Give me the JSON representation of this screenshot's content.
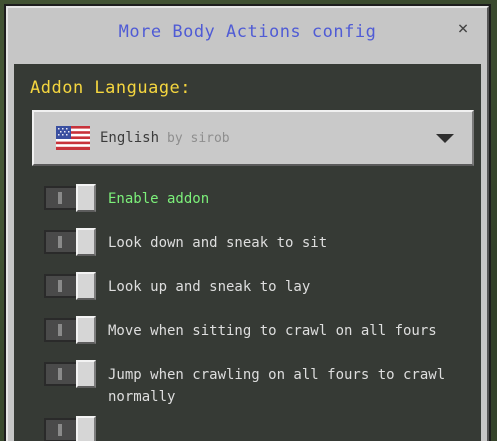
{
  "dialog": {
    "title": "More Body Actions config",
    "close_symbol": "×"
  },
  "language": {
    "heading": "Addon Language:",
    "selected": "English",
    "author": "by sirob",
    "flag_icon": "us-flag-icon"
  },
  "options": [
    {
      "label": "Enable addon",
      "highlighted": true
    },
    {
      "label": "Look down and sneak to sit",
      "highlighted": false
    },
    {
      "label": "Look up and sneak to lay",
      "highlighted": false
    },
    {
      "label": "Move when sitting to crawl on all fours",
      "highlighted": false
    },
    {
      "label": "Jump when crawling on all fours to crawl normally",
      "highlighted": false
    }
  ],
  "colors": {
    "title": "#4f5bd5",
    "heading": "#f5d63f",
    "active_label": "#7cf07a",
    "label": "#dedede"
  }
}
